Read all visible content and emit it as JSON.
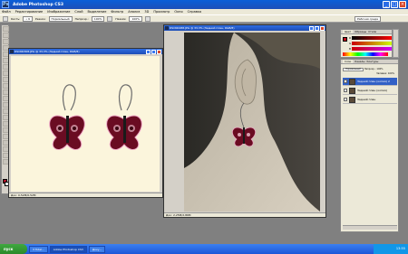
{
  "app": {
    "title": "Adobe Photoshop CS3",
    "icon_label": "Ps"
  },
  "menu": [
    "Файл",
    "Редактирование",
    "Изображение",
    "Слой",
    "Выделение",
    "Фильтр",
    "Анализ",
    "3D",
    "Просмотр",
    "Окно",
    "Справка"
  ],
  "options": {
    "tool_label": "Кисть:",
    "mode_label": "Режим:",
    "mode_value": "Нормальный",
    "opacity_label": "Непрозр.:",
    "opacity_value": "100%",
    "flow_label": "Нажим:",
    "flow_value": "100%",
    "workspace_label": "Рабочая среда"
  },
  "doc1": {
    "title": "DSCN0308.JPG @ 33,3% (Задний план, RGB/8)",
    "status": "Док: 0,52М/0,52М"
  },
  "doc2": {
    "title": "DSCN0288.JPG @ 33,3% (Задний план, RGB/8)",
    "status": "Док: 2,25М/2,86М"
  },
  "color_panel": {
    "tabs": [
      "Цвет",
      "Образцы",
      "Стили"
    ],
    "channels": [
      "R",
      "G",
      "B"
    ],
    "fg_color": "#c00c1c"
  },
  "layers_panel": {
    "tabs": [
      "Слои",
      "Каналы",
      "Контуры"
    ],
    "mode": "Нормальный",
    "opacity_label": "Непрозр.:",
    "opacity_value": "100%",
    "fill_label": "Заливка:",
    "fill_value": "100%",
    "layers": [
      {
        "name": "Задний план (копия) 2",
        "selected": true
      },
      {
        "name": "Задний план (копия)",
        "selected": false
      },
      {
        "name": "Задний план",
        "selected": false
      }
    ]
  },
  "taskbar": {
    "start": "пуск",
    "tasks": [
      "3 Total...",
      "Adobe Photoshop CS3",
      "Доку..."
    ],
    "clock": "13:55"
  }
}
